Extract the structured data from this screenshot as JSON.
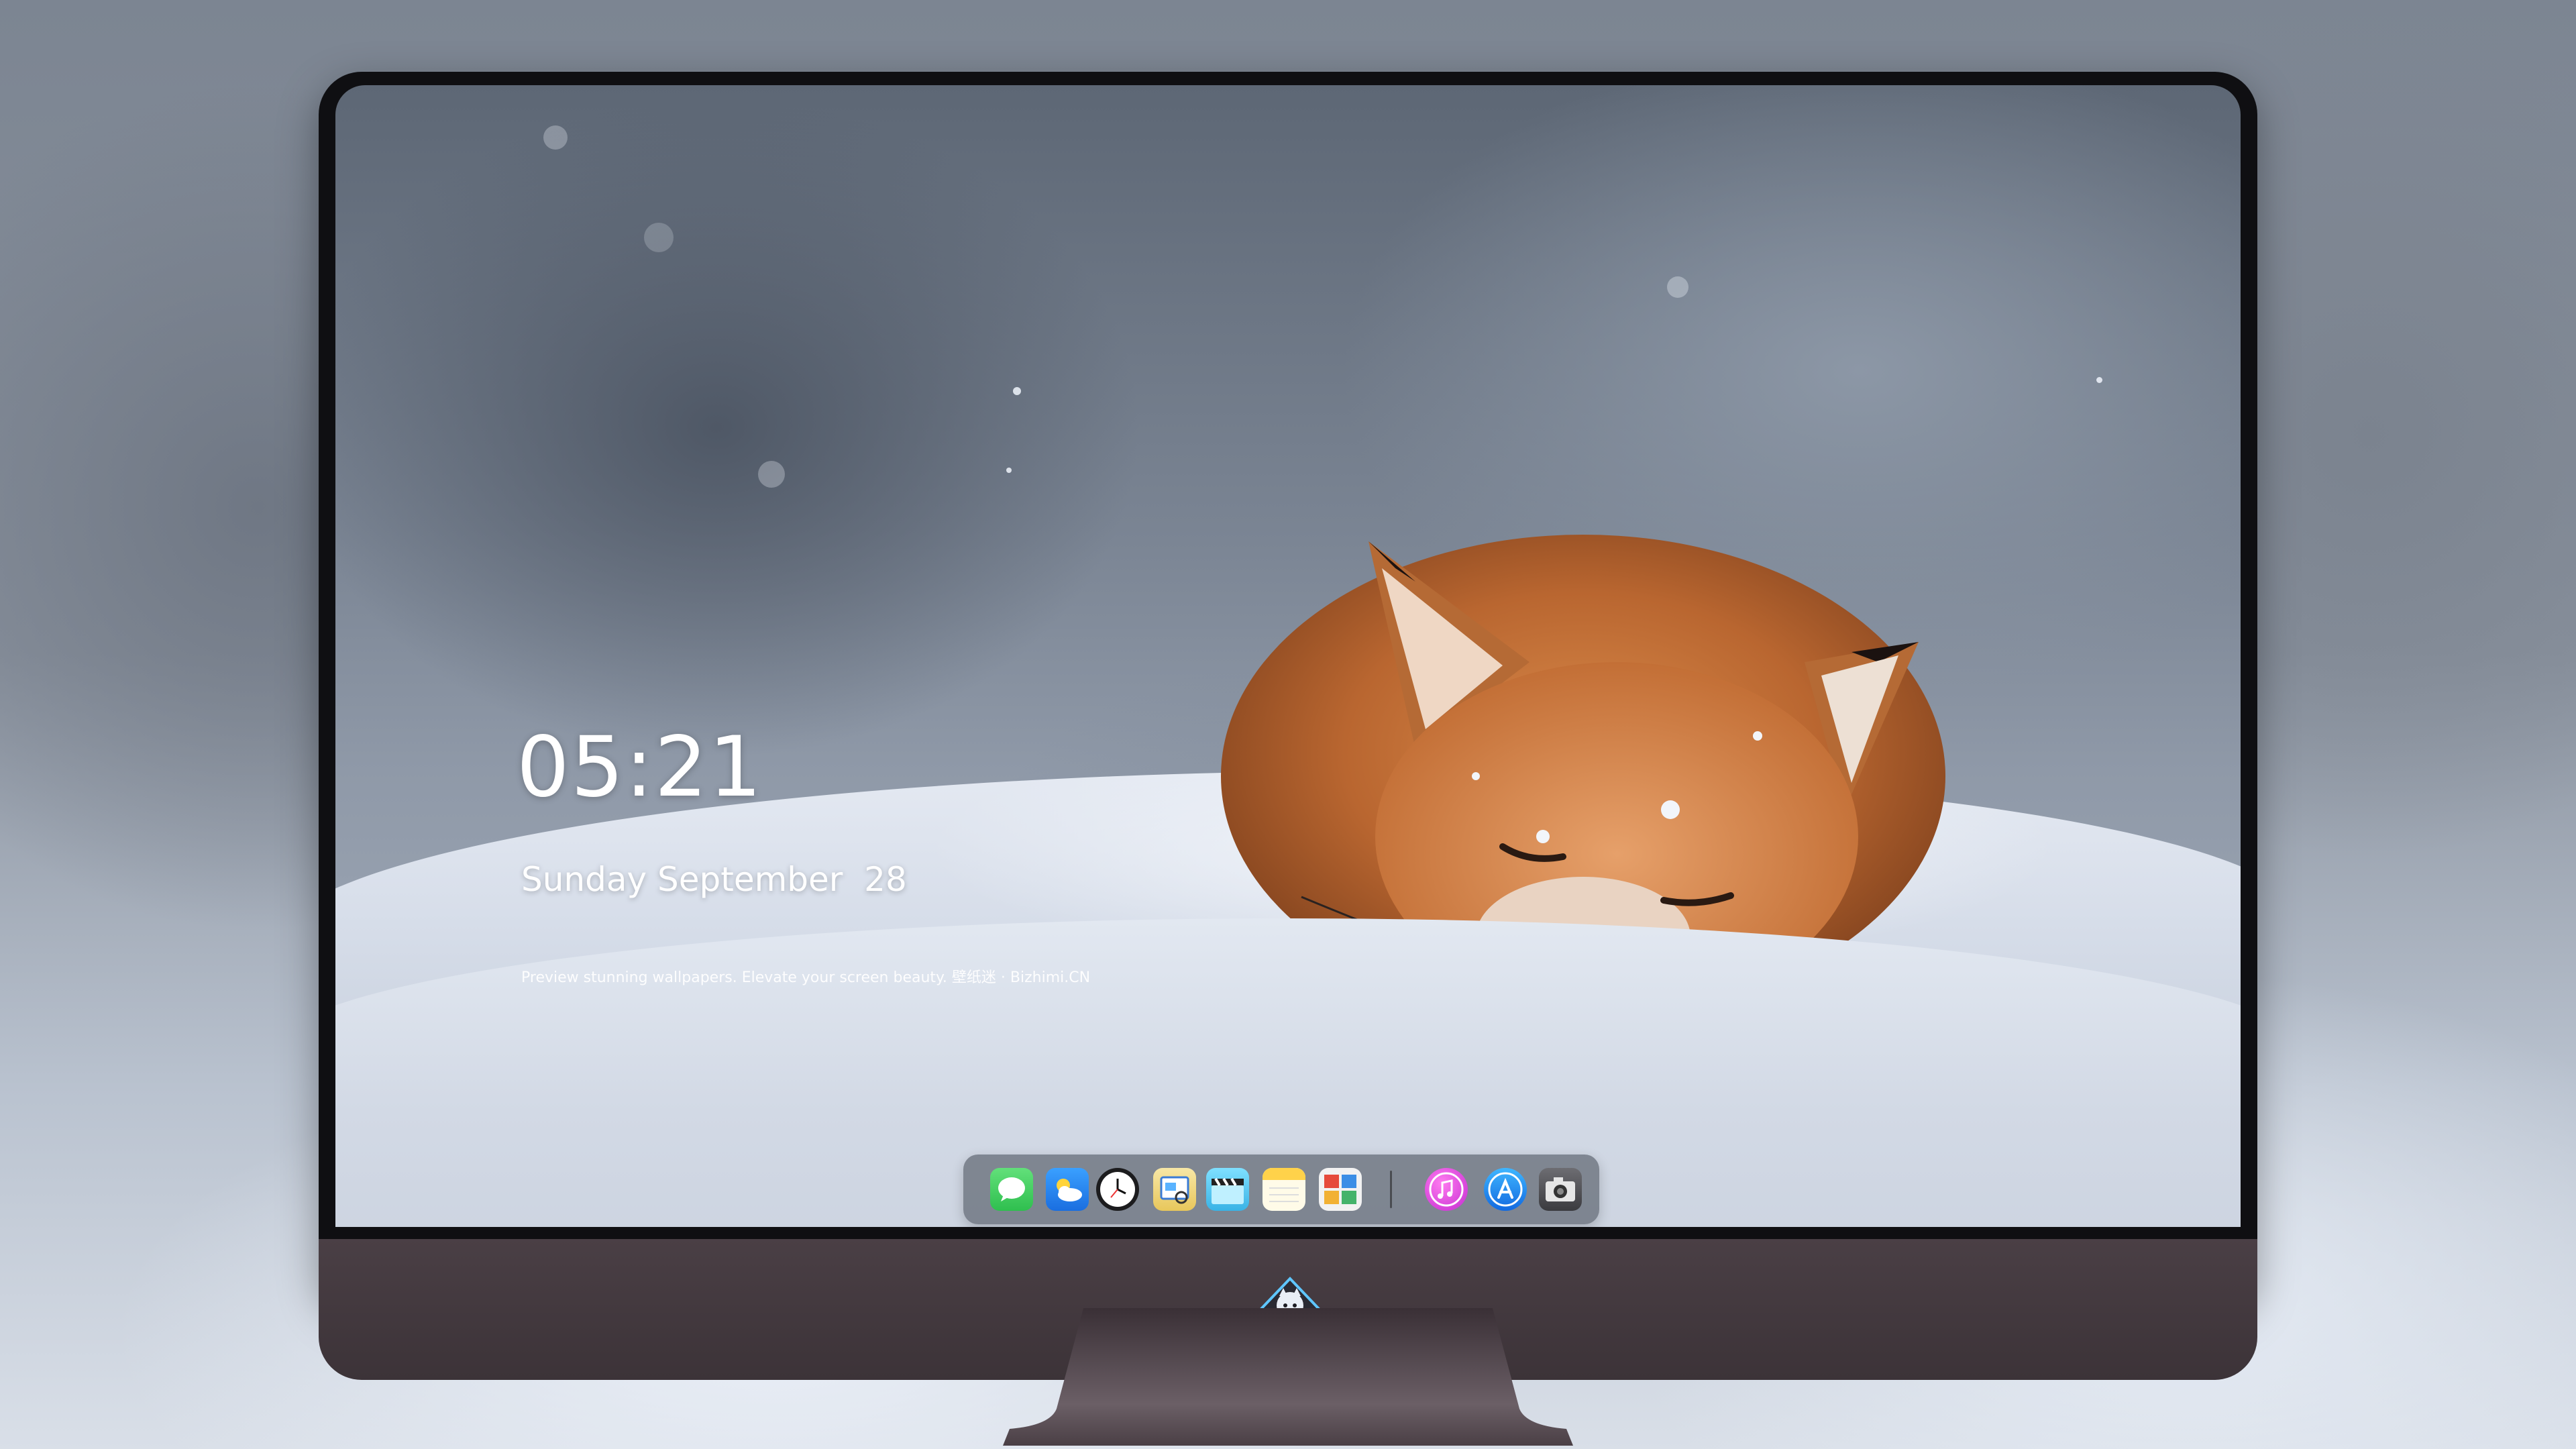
{
  "lock_screen": {
    "time": "05:21",
    "date": "Sunday September  28",
    "tagline": "Preview stunning wallpapers. Elevate your screen beauty. 壁纸迷 · Bizhimi.CN"
  },
  "dock": {
    "apps": [
      {
        "name": "Messages",
        "icon": "messages-icon",
        "color": "#34c759"
      },
      {
        "name": "Weather",
        "icon": "weather-icon",
        "color": "#2f80ed"
      },
      {
        "name": "Clock",
        "icon": "clock-icon",
        "color": "#1c1c1e"
      },
      {
        "name": "Preview",
        "icon": "preview-icon",
        "color": "#f4c542"
      },
      {
        "name": "Clips",
        "icon": "clapperboard-icon",
        "color": "#5ac8fa"
      },
      {
        "name": "Notes",
        "icon": "notes-icon",
        "color": "#ffd64a"
      },
      {
        "name": "Calendar Widget",
        "icon": "widget-calendar-icon",
        "color": "#f2f2f2"
      },
      {
        "name": "iTunes",
        "icon": "music-note-icon",
        "color": "#e73fd6"
      },
      {
        "name": "App Store",
        "icon": "app-store-icon",
        "color": "#1e90ff"
      },
      {
        "name": "Camera",
        "icon": "camera-icon",
        "color": "#5a5a5e"
      }
    ]
  },
  "colors": {
    "bezel": "#0f0f12",
    "chin": "#4a3f45",
    "dock_bg": "rgba(95,102,114,0.72)"
  },
  "chin_logo": "fox-mascot-logo-icon"
}
